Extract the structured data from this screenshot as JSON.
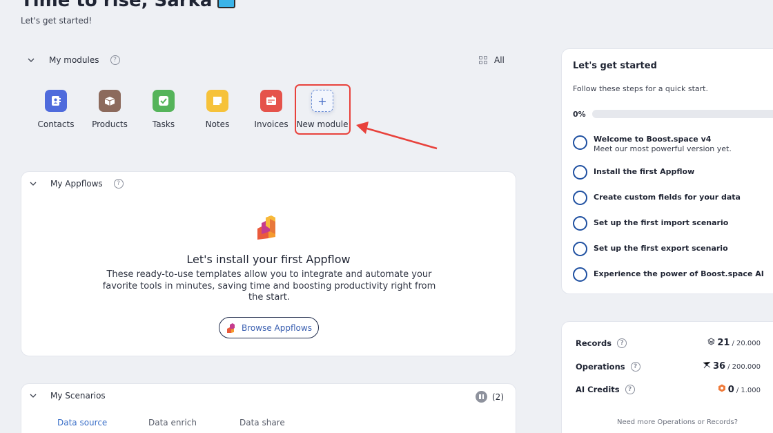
{
  "header": {
    "greeting": "Time to rise, Šárka",
    "subtitle": "Let's get started!"
  },
  "modules": {
    "title": "My modules",
    "help": "?",
    "all_label": "All",
    "items": [
      {
        "label": "Contacts",
        "icon": "contacts-icon",
        "color": "#4f6bdc"
      },
      {
        "label": "Products",
        "icon": "box-icon",
        "color": "#8c6a5c"
      },
      {
        "label": "Tasks",
        "icon": "check-icon",
        "color": "#55b45a"
      },
      {
        "label": "Notes",
        "icon": "note-icon",
        "color": "#f6c23a"
      },
      {
        "label": "Invoices",
        "icon": "invoice-icon",
        "color": "#e5534b"
      }
    ],
    "new_module": {
      "label": "New module",
      "icon": "plus-icon",
      "highlight_color": "#e8413b"
    }
  },
  "appflows": {
    "title": "My Appflows",
    "help": "?",
    "empty_title": "Let's install your first Appflow",
    "empty_desc": "These ready-to-use templates allow you to integrate and automate your favorite tools in minutes, saving time and boosting productivity right from the start.",
    "browse_label": "Browse Appflows"
  },
  "scenarios": {
    "title": "My Scenarios",
    "count": "(2)",
    "tabs": [
      "Data source",
      "Data enrich",
      "Data share"
    ],
    "active_tab": 0
  },
  "get_started": {
    "title": "Let's get started",
    "subtitle": "Follow these steps for a quick start.",
    "progress_label": "0%",
    "progress": 0,
    "steps": [
      {
        "title": "Welcome to Boost.space v4",
        "desc": "Meet our most powerful version yet."
      },
      {
        "title": "Install the first Appflow",
        "desc": ""
      },
      {
        "title": "Create custom fields for your data",
        "desc": ""
      },
      {
        "title": "Set up the first import scenario",
        "desc": ""
      },
      {
        "title": "Set up the first export scenario",
        "desc": ""
      },
      {
        "title": "Experience the power of Boost.space AI",
        "desc": ""
      }
    ]
  },
  "usage": {
    "records": {
      "label": "Records",
      "value": "21",
      "max": "/ 20.000",
      "icon": "layers-icon"
    },
    "operations": {
      "label": "Operations",
      "value": "36",
      "max": "/ 200.000",
      "icon": "nodes-icon"
    },
    "ai_credits": {
      "label": "AI Credits",
      "value": "0",
      "max": "/ 1.000",
      "icon": "hex-icon"
    },
    "need_more": "Need more Operations or Records?"
  },
  "colors": {
    "accent": "#3a6fc8",
    "highlight": "#e8413b",
    "ring": "#1e4fa0"
  }
}
